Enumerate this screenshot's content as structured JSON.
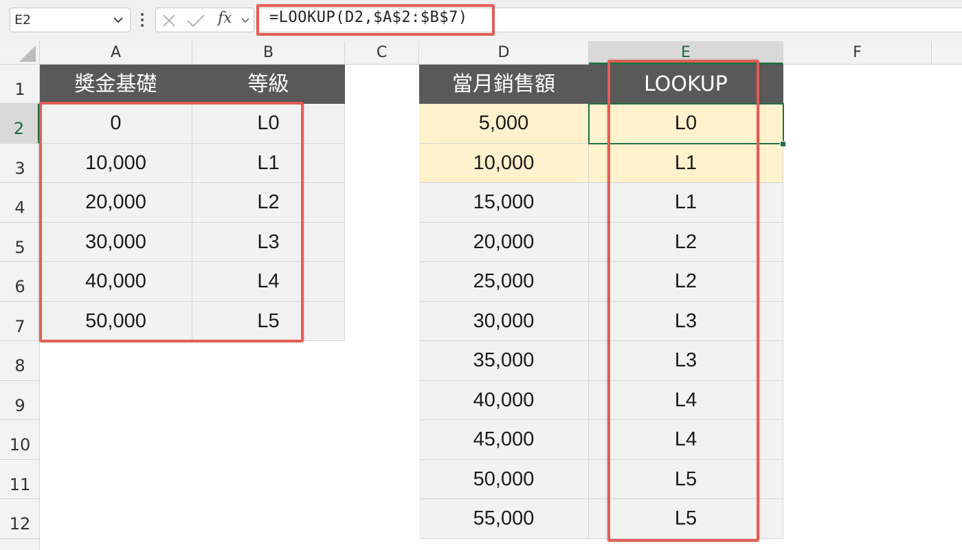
{
  "formula_bar": {
    "name_box": "E2",
    "formula": "=LOOKUP(D2,$A$2:$B$7)",
    "fx_label": "fx"
  },
  "columns": [
    "A",
    "B",
    "C",
    "D",
    "E",
    "F"
  ],
  "rows": [
    "1",
    "2",
    "3",
    "4",
    "5",
    "6",
    "7",
    "8",
    "9",
    "10",
    "11",
    "12"
  ],
  "table1": {
    "headers": [
      "獎金基礎",
      "等級"
    ],
    "rows": [
      [
        "0",
        "L0"
      ],
      [
        "10,000",
        "L1"
      ],
      [
        "20,000",
        "L2"
      ],
      [
        "30,000",
        "L3"
      ],
      [
        "40,000",
        "L4"
      ],
      [
        "50,000",
        "L5"
      ]
    ]
  },
  "table2": {
    "headers": [
      "當月銷售額",
      "LOOKUP"
    ],
    "rows": [
      [
        "5,000",
        "L0"
      ],
      [
        "10,000",
        "L1"
      ],
      [
        "15,000",
        "L1"
      ],
      [
        "20,000",
        "L2"
      ],
      [
        "25,000",
        "L2"
      ],
      [
        "30,000",
        "L3"
      ],
      [
        "35,000",
        "L3"
      ],
      [
        "40,000",
        "L4"
      ],
      [
        "45,000",
        "L4"
      ],
      [
        "50,000",
        "L5"
      ],
      [
        "55,000",
        "L5"
      ]
    ]
  },
  "colors": {
    "header_fill": "#595959",
    "highlight_fill": "#fff2cc",
    "annotation_red": "#e35d55",
    "selection_green": "#1e7145"
  }
}
